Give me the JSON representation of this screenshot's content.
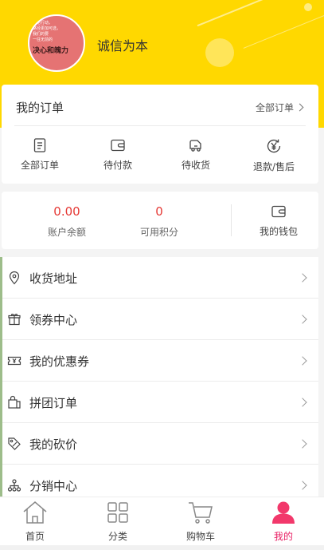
{
  "profile": {
    "username": "诚信为本",
    "avatar_text": {
      "lines": [
        "总结行动，",
        "路径更加可选，",
        "我们的要",
        "一往无前的"
      ],
      "title": "决心和魄力"
    }
  },
  "orders": {
    "title": "我的订单",
    "all_link": "全部订单",
    "items": [
      {
        "label": "全部订单",
        "icon": "order-list-icon"
      },
      {
        "label": "待付款",
        "icon": "wallet-icon"
      },
      {
        "label": "待收货",
        "icon": "truck-icon"
      },
      {
        "label": "退款/售后",
        "icon": "yen-refund-icon"
      }
    ]
  },
  "wallet": {
    "balance_value": "0.00",
    "balance_label": "账户余额",
    "points_value": "0",
    "points_label": "可用积分",
    "wallet_label": "我的钱包"
  },
  "menu": {
    "items": [
      {
        "label": "收货地址",
        "icon": "location-pin-icon"
      },
      {
        "label": "领券中心",
        "icon": "gift-icon"
      },
      {
        "label": "我的优惠券",
        "icon": "coupon-ticket-icon"
      },
      {
        "label": "拼团订单",
        "icon": "group-bag-icon"
      },
      {
        "label": "我的砍价",
        "icon": "price-tag-icon"
      },
      {
        "label": "分销中心",
        "icon": "network-icon"
      }
    ]
  },
  "tabbar": {
    "items": [
      {
        "label": "首页",
        "icon": "home-icon"
      },
      {
        "label": "分类",
        "icon": "category-grid-icon"
      },
      {
        "label": "购物车",
        "icon": "cart-icon"
      },
      {
        "label": "我的",
        "icon": "user-icon"
      }
    ],
    "active_index": 3
  },
  "colors": {
    "header_bg": "#ffd800",
    "accent_red": "#e53935",
    "active_tab": "#e91e63"
  }
}
